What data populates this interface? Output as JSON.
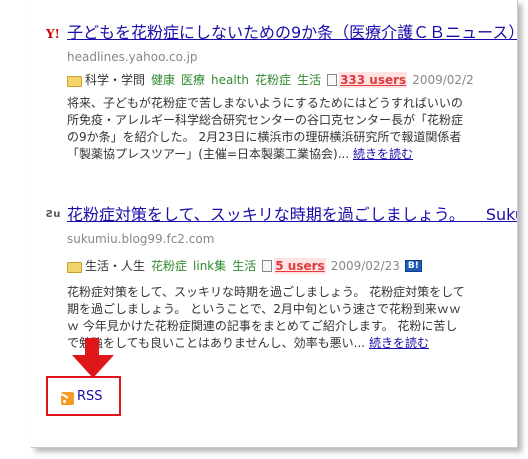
{
  "entries": [
    {
      "favicon": "Y!",
      "title": "子どもを花粉症にしないための9か条（医療介護ＣＢニュース）",
      "domain": "headlines.yahoo.co.jp",
      "category": "科学・学問",
      "tags": [
        "健康",
        "医療",
        "health",
        "花粉症",
        "生活"
      ],
      "users": "333 users",
      "date": "2009/02/2",
      "excerpt_lines": [
        "将来、子どもが花粉症で苦しまないようにするためにはどうすればいいの",
        "所免疫・アレルギー科学総合研究センターの谷口克センター長が「花粉症",
        "の9か条」を紹介した。 2月23日に横浜市の理研横浜研究所で報道関係者",
        "「製薬協プレスツアー」(主催=日本製薬工業協会)..."
      ],
      "more_label": "続きを読む"
    },
    {
      "favicon": "Ƨu",
      "title": "花粉症対策をして、スッキリな時期を過ごしましょう。 　Sukumiu",
      "domain": "sukumiu.blog99.fc2.com",
      "category": "生活・人生",
      "tags": [
        "花粉症",
        "link集",
        "生活"
      ],
      "users": "5 users",
      "date": "2009/02/23",
      "badge": "B!",
      "excerpt_lines": [
        "花粉症対策をして、スッキリな時期を過ごしましょう。 花粉症対策をして",
        "期を過ごしましょう。 ということで、2月中旬という速さで花粉到来ｗｗ",
        "ｗ 今年見かけた花粉症関連の記事をまとめてご紹介します。 花粉に苦し",
        "で勉強をしても良いことはありませんし、効率も悪い..."
      ],
      "more_label": "続きを読む"
    }
  ],
  "rss": {
    "label": "RSS",
    "icon": "rss-feed-icon"
  },
  "annotation": {
    "arrow_color": "#e0171a",
    "highlight_color": "#e0171a"
  },
  "colors": {
    "link": "#1a0dab",
    "tag": "#2f8a2f",
    "users": "#e0393e",
    "muted": "#888888"
  }
}
